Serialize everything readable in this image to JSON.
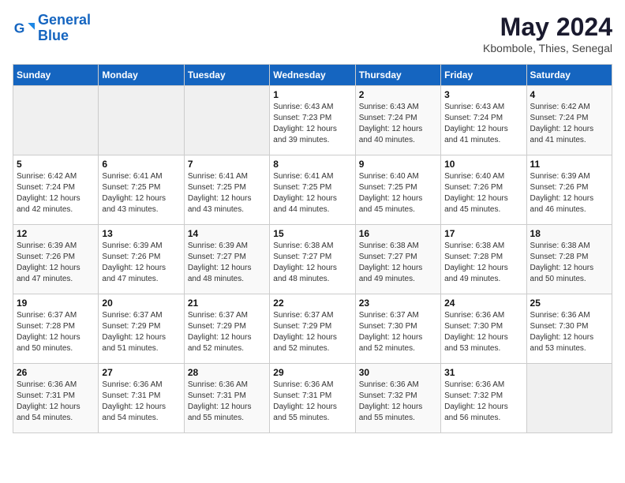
{
  "logo": {
    "line1": "General",
    "line2": "Blue"
  },
  "title": "May 2024",
  "subtitle": "Kbombole, Thies, Senegal",
  "days_of_week": [
    "Sunday",
    "Monday",
    "Tuesday",
    "Wednesday",
    "Thursday",
    "Friday",
    "Saturday"
  ],
  "weeks": [
    [
      {
        "day": "",
        "info": ""
      },
      {
        "day": "",
        "info": ""
      },
      {
        "day": "",
        "info": ""
      },
      {
        "day": "1",
        "sunrise": "Sunrise: 6:43 AM",
        "sunset": "Sunset: 7:23 PM",
        "daylight": "Daylight: 12 hours and 39 minutes."
      },
      {
        "day": "2",
        "sunrise": "Sunrise: 6:43 AM",
        "sunset": "Sunset: 7:24 PM",
        "daylight": "Daylight: 12 hours and 40 minutes."
      },
      {
        "day": "3",
        "sunrise": "Sunrise: 6:43 AM",
        "sunset": "Sunset: 7:24 PM",
        "daylight": "Daylight: 12 hours and 41 minutes."
      },
      {
        "day": "4",
        "sunrise": "Sunrise: 6:42 AM",
        "sunset": "Sunset: 7:24 PM",
        "daylight": "Daylight: 12 hours and 41 minutes."
      }
    ],
    [
      {
        "day": "5",
        "sunrise": "Sunrise: 6:42 AM",
        "sunset": "Sunset: 7:24 PM",
        "daylight": "Daylight: 12 hours and 42 minutes."
      },
      {
        "day": "6",
        "sunrise": "Sunrise: 6:41 AM",
        "sunset": "Sunset: 7:25 PM",
        "daylight": "Daylight: 12 hours and 43 minutes."
      },
      {
        "day": "7",
        "sunrise": "Sunrise: 6:41 AM",
        "sunset": "Sunset: 7:25 PM",
        "daylight": "Daylight: 12 hours and 43 minutes."
      },
      {
        "day": "8",
        "sunrise": "Sunrise: 6:41 AM",
        "sunset": "Sunset: 7:25 PM",
        "daylight": "Daylight: 12 hours and 44 minutes."
      },
      {
        "day": "9",
        "sunrise": "Sunrise: 6:40 AM",
        "sunset": "Sunset: 7:25 PM",
        "daylight": "Daylight: 12 hours and 45 minutes."
      },
      {
        "day": "10",
        "sunrise": "Sunrise: 6:40 AM",
        "sunset": "Sunset: 7:26 PM",
        "daylight": "Daylight: 12 hours and 45 minutes."
      },
      {
        "day": "11",
        "sunrise": "Sunrise: 6:39 AM",
        "sunset": "Sunset: 7:26 PM",
        "daylight": "Daylight: 12 hours and 46 minutes."
      }
    ],
    [
      {
        "day": "12",
        "sunrise": "Sunrise: 6:39 AM",
        "sunset": "Sunset: 7:26 PM",
        "daylight": "Daylight: 12 hours and 47 minutes."
      },
      {
        "day": "13",
        "sunrise": "Sunrise: 6:39 AM",
        "sunset": "Sunset: 7:26 PM",
        "daylight": "Daylight: 12 hours and 47 minutes."
      },
      {
        "day": "14",
        "sunrise": "Sunrise: 6:39 AM",
        "sunset": "Sunset: 7:27 PM",
        "daylight": "Daylight: 12 hours and 48 minutes."
      },
      {
        "day": "15",
        "sunrise": "Sunrise: 6:38 AM",
        "sunset": "Sunset: 7:27 PM",
        "daylight": "Daylight: 12 hours and 48 minutes."
      },
      {
        "day": "16",
        "sunrise": "Sunrise: 6:38 AM",
        "sunset": "Sunset: 7:27 PM",
        "daylight": "Daylight: 12 hours and 49 minutes."
      },
      {
        "day": "17",
        "sunrise": "Sunrise: 6:38 AM",
        "sunset": "Sunset: 7:28 PM",
        "daylight": "Daylight: 12 hours and 49 minutes."
      },
      {
        "day": "18",
        "sunrise": "Sunrise: 6:38 AM",
        "sunset": "Sunset: 7:28 PM",
        "daylight": "Daylight: 12 hours and 50 minutes."
      }
    ],
    [
      {
        "day": "19",
        "sunrise": "Sunrise: 6:37 AM",
        "sunset": "Sunset: 7:28 PM",
        "daylight": "Daylight: 12 hours and 50 minutes."
      },
      {
        "day": "20",
        "sunrise": "Sunrise: 6:37 AM",
        "sunset": "Sunset: 7:29 PM",
        "daylight": "Daylight: 12 hours and 51 minutes."
      },
      {
        "day": "21",
        "sunrise": "Sunrise: 6:37 AM",
        "sunset": "Sunset: 7:29 PM",
        "daylight": "Daylight: 12 hours and 52 minutes."
      },
      {
        "day": "22",
        "sunrise": "Sunrise: 6:37 AM",
        "sunset": "Sunset: 7:29 PM",
        "daylight": "Daylight: 12 hours and 52 minutes."
      },
      {
        "day": "23",
        "sunrise": "Sunrise: 6:37 AM",
        "sunset": "Sunset: 7:30 PM",
        "daylight": "Daylight: 12 hours and 52 minutes."
      },
      {
        "day": "24",
        "sunrise": "Sunrise: 6:36 AM",
        "sunset": "Sunset: 7:30 PM",
        "daylight": "Daylight: 12 hours and 53 minutes."
      },
      {
        "day": "25",
        "sunrise": "Sunrise: 6:36 AM",
        "sunset": "Sunset: 7:30 PM",
        "daylight": "Daylight: 12 hours and 53 minutes."
      }
    ],
    [
      {
        "day": "26",
        "sunrise": "Sunrise: 6:36 AM",
        "sunset": "Sunset: 7:31 PM",
        "daylight": "Daylight: 12 hours and 54 minutes."
      },
      {
        "day": "27",
        "sunrise": "Sunrise: 6:36 AM",
        "sunset": "Sunset: 7:31 PM",
        "daylight": "Daylight: 12 hours and 54 minutes."
      },
      {
        "day": "28",
        "sunrise": "Sunrise: 6:36 AM",
        "sunset": "Sunset: 7:31 PM",
        "daylight": "Daylight: 12 hours and 55 minutes."
      },
      {
        "day": "29",
        "sunrise": "Sunrise: 6:36 AM",
        "sunset": "Sunset: 7:31 PM",
        "daylight": "Daylight: 12 hours and 55 minutes."
      },
      {
        "day": "30",
        "sunrise": "Sunrise: 6:36 AM",
        "sunset": "Sunset: 7:32 PM",
        "daylight": "Daylight: 12 hours and 55 minutes."
      },
      {
        "day": "31",
        "sunrise": "Sunrise: 6:36 AM",
        "sunset": "Sunset: 7:32 PM",
        "daylight": "Daylight: 12 hours and 56 minutes."
      },
      {
        "day": "",
        "info": ""
      }
    ]
  ]
}
